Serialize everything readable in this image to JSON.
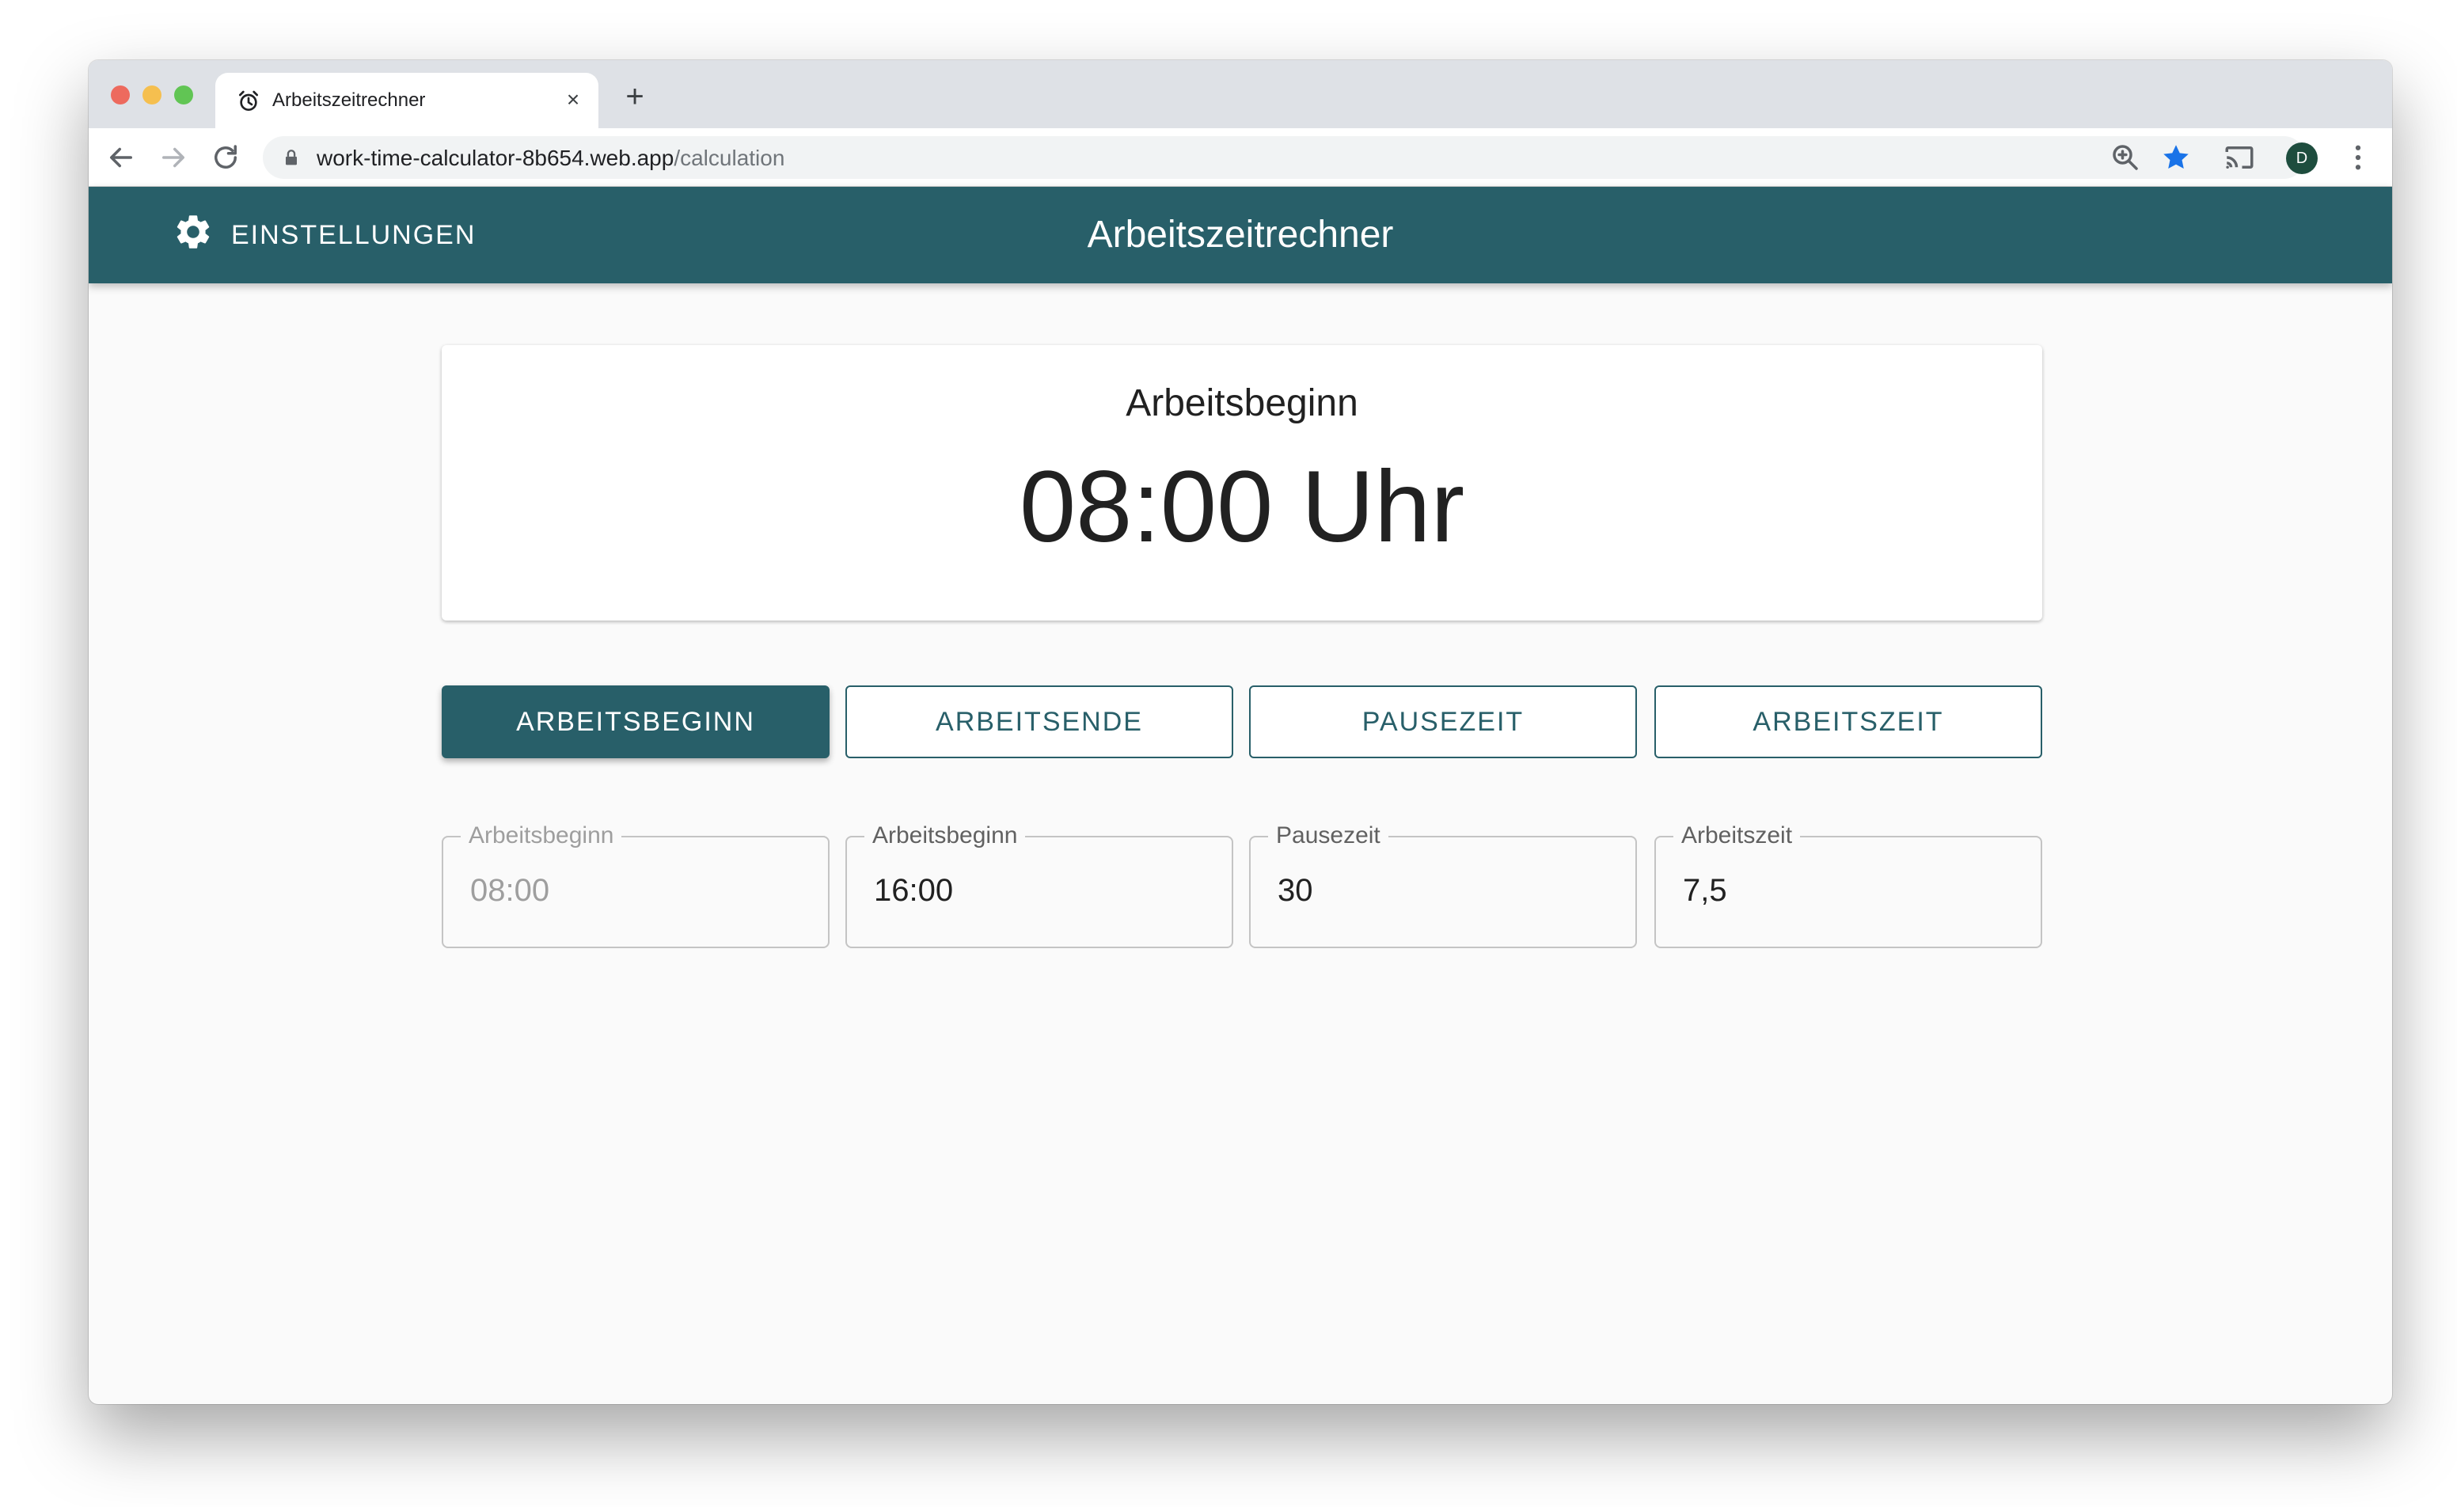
{
  "browser": {
    "tab_title": "Arbeitszeitrechner",
    "tab_close": "×",
    "new_tab": "+",
    "url_host": "work-time-calculator-8b654.web.app",
    "url_path": "/calculation",
    "profile_initial": "D"
  },
  "app": {
    "settings_label": "EINSTELLUNGEN",
    "title": "Arbeitszeitrechner",
    "primary_color": "#285f69"
  },
  "result": {
    "label": "Arbeitsbeginn",
    "value": "08:00 Uhr"
  },
  "modes": [
    {
      "label": "ARBEITSBEGINN",
      "active": true
    },
    {
      "label": "ARBEITSENDE",
      "active": false
    },
    {
      "label": "PAUSEZEIT",
      "active": false
    },
    {
      "label": "ARBEITSZEIT",
      "active": false
    }
  ],
  "fields": [
    {
      "label": "Arbeitsbeginn",
      "value": "08:00",
      "disabled": true
    },
    {
      "label": "Arbeitsbeginn",
      "value": "16:00",
      "disabled": false
    },
    {
      "label": "Pausezeit",
      "value": "30",
      "disabled": false
    },
    {
      "label": "Arbeitszeit",
      "value": "7,5",
      "disabled": false
    }
  ]
}
